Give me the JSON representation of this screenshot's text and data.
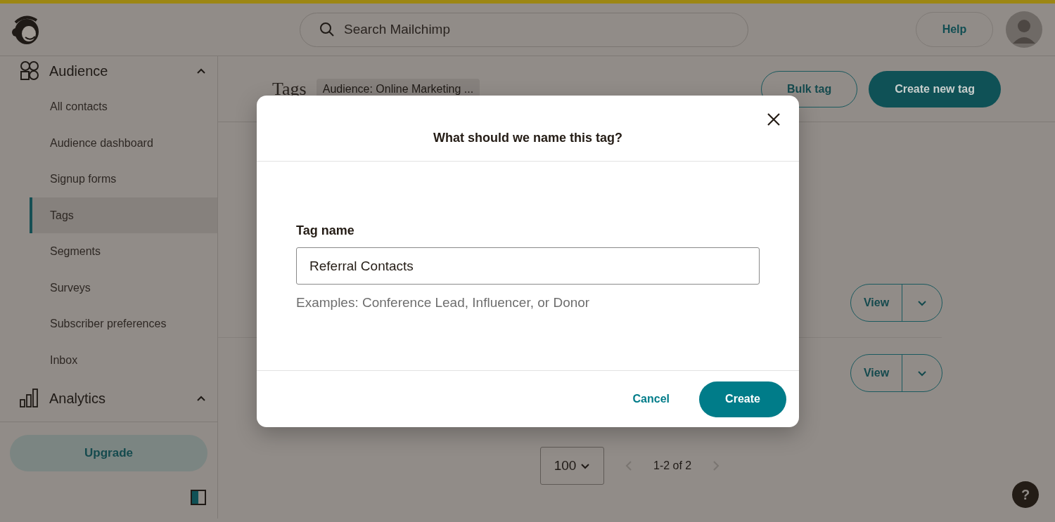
{
  "top_bar": {
    "search": {
      "placeholder": "Search Mailchimp"
    },
    "help_button": "Help"
  },
  "sidebar": {
    "sections": [
      {
        "label": "Audience",
        "expanded": true,
        "items": [
          {
            "label": "All contacts",
            "selected": false
          },
          {
            "label": "Audience dashboard",
            "selected": false
          },
          {
            "label": "Signup forms",
            "selected": false
          },
          {
            "label": "Tags",
            "selected": true
          },
          {
            "label": "Segments",
            "selected": false
          },
          {
            "label": "Surveys",
            "selected": false
          },
          {
            "label": "Subscriber preferences",
            "selected": false
          },
          {
            "label": "Inbox",
            "selected": false
          }
        ]
      },
      {
        "label": "Analytics",
        "expanded": true
      }
    ],
    "upgrade_button": "Upgrade"
  },
  "page": {
    "title": "Tags",
    "audience_badge": "Audience: Online Marketing ...",
    "buttons": [
      {
        "label": "Bulk tag",
        "kind": "outline"
      },
      {
        "label": "Create new tag",
        "kind": "primary"
      }
    ],
    "rows": [
      {
        "action": "View"
      },
      {
        "action": "View"
      }
    ],
    "pagination": {
      "page_size": "100",
      "range": "1-2 of 2"
    }
  },
  "dialog": {
    "title": "What should we name this tag?",
    "field_label": "Tag name",
    "field_value": "Referral Contacts",
    "hint": "Examples: Conference Lead, Influencer, or Donor",
    "buttons": [
      {
        "label": "Cancel",
        "kind": "link"
      },
      {
        "label": "Create",
        "kind": "primary"
      }
    ]
  },
  "help_fab": "?"
}
